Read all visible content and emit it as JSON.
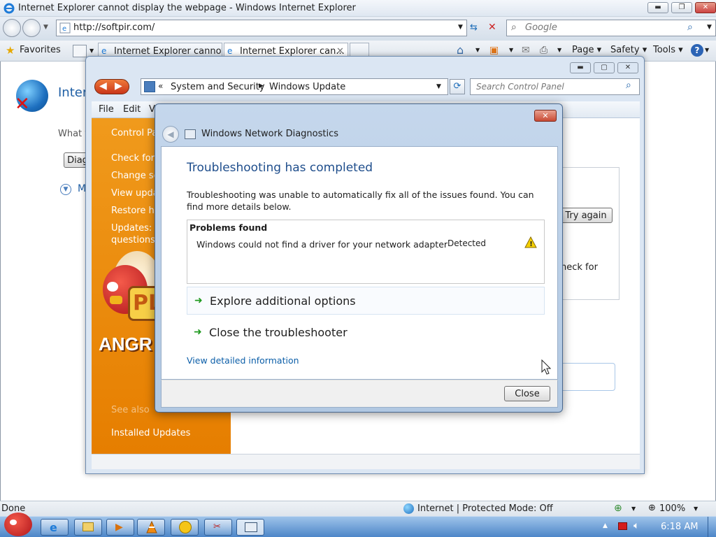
{
  "ie": {
    "title": "Internet Explorer cannot display the webpage - Windows Internet Explorer",
    "address": "http://softpir.com/",
    "search_placeholder": "Google",
    "favorites_label": "Favorites",
    "tabs": [
      "Internet Explorer cannot...",
      "Internet Explorer can..."
    ],
    "commands": {
      "page": "Page ▾",
      "safety": "Safety ▾",
      "tools": "Tools ▾"
    },
    "background_page": {
      "heading": "Intern",
      "subtext": "What y",
      "diag_button": "Diag",
      "more_link": "M"
    },
    "status": {
      "left": "Done",
      "zone": "Internet | Protected Mode: Off",
      "zoom": "100%"
    }
  },
  "control_panel": {
    "breadcrumb": [
      "System and Security",
      "Windows Update"
    ],
    "search_placeholder": "Search Control Panel",
    "menu": [
      "File",
      "Edit",
      "V"
    ],
    "left_links": [
      "Control Pa",
      "Check for",
      "Change se",
      "View upda",
      "Restore hi",
      "Updates: f",
      "questions"
    ],
    "see_also_label": "See also",
    "installed_updates": "Installed Updates",
    "try_again_label": "Try again",
    "check_for_text": "neck for",
    "banner_text": "PL",
    "angry_text": "ANGR"
  },
  "dialog": {
    "title": "Windows Network Diagnostics",
    "heading": "Troubleshooting has completed",
    "description": "Troubleshooting was unable to automatically fix all of the issues found. You can find more details below.",
    "problems_header": "Problems found",
    "problem": {
      "text": "Windows could not find a driver for your network adapter",
      "status": "Detected"
    },
    "options": [
      "Explore additional options",
      "Close the troubleshooter"
    ],
    "detail_link": "View detailed information",
    "close_button": "Close"
  },
  "taskbar": {
    "time": "6:18 AM"
  },
  "colors": {
    "accent": "#1f5fa5",
    "cp_sidebar": "#e98a10",
    "link": "#0b5ea8",
    "arrow": "#1f9a1f"
  }
}
